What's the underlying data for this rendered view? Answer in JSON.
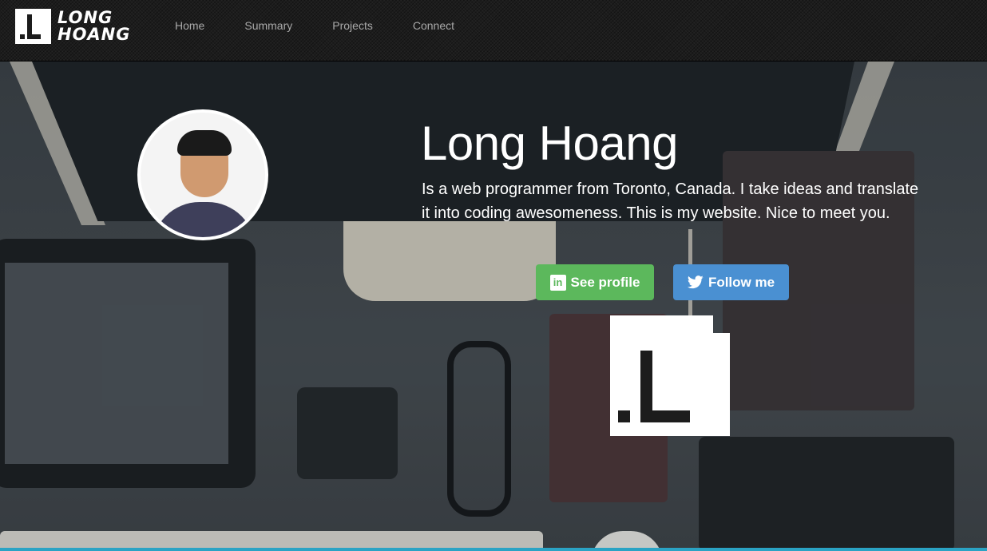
{
  "brand": {
    "line1": "LONG",
    "line2": "HOANG",
    "mark": ".L"
  },
  "nav": {
    "items": [
      {
        "label": "Home"
      },
      {
        "label": "Summary"
      },
      {
        "label": "Projects"
      },
      {
        "label": "Connect"
      }
    ]
  },
  "hero": {
    "title": "Long Hoang",
    "description": "Is a web programmer from Toronto, Canada. I take ideas and translate it into coding awesomeness. This is my website. Nice to meet you.",
    "buttons": {
      "profile_label": "See profile",
      "follow_label": "Follow me"
    }
  },
  "icons": {
    "linkedin": "linkedin-icon",
    "twitter": "twitter-icon"
  },
  "colors": {
    "profile_button": "#5cb85c",
    "follow_button": "#4a90d2",
    "accent_bar": "#2aa3c4"
  }
}
